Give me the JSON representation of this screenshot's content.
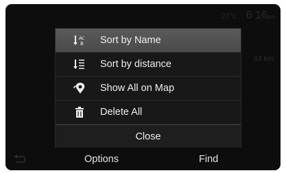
{
  "status": {
    "temperature": "27°c",
    "time": "6 16",
    "ampm": "pm"
  },
  "background_list": {
    "distance": "33 km"
  },
  "options_menu": {
    "items": [
      {
        "label": "Sort by Name",
        "icon": "sort-alpha-icon",
        "selected": true
      },
      {
        "label": "Sort by distance",
        "icon": "sort-distance-icon",
        "selected": false
      },
      {
        "label": "Show All on Map",
        "icon": "map-pin-icon",
        "selected": false
      },
      {
        "label": "Delete All",
        "icon": "trash-icon",
        "selected": false
      }
    ],
    "close_label": "Close"
  },
  "bottom_bar": {
    "back_icon": "back-arrow-icon",
    "options_label": "Options",
    "find_label": "Find"
  },
  "colors": {
    "screen_bg": "#0d0d0d",
    "menu_bg": "#181818",
    "selected_bg": "#4f4f4f",
    "text": "#eeeeee"
  }
}
